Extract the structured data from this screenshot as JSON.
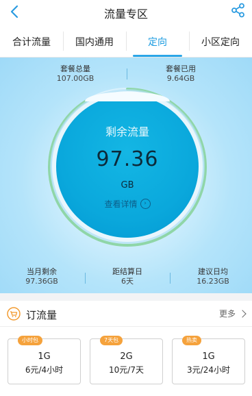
{
  "header": {
    "title": "流量专区",
    "back_icon": "chevron-left-icon",
    "share_icon": "share-icon"
  },
  "tabs": [
    {
      "label": "合计流量",
      "active": false
    },
    {
      "label": "国内通用",
      "active": false
    },
    {
      "label": "定向",
      "active": true
    },
    {
      "label": "小区定向",
      "active": false
    }
  ],
  "summary": {
    "total_label": "套餐总量",
    "total_value": "107.00GB",
    "used_label": "套餐已用",
    "used_value": "9.64GB"
  },
  "ball": {
    "label": "剩余流量",
    "value": "97.36",
    "unit": "GB",
    "detail": "查看详情",
    "remaining_fraction": 0.91
  },
  "bottom_stats": [
    {
      "label": "当月剩余",
      "value": "97.36GB"
    },
    {
      "label": "距结算日",
      "value": "6天"
    },
    {
      "label": "建议日均",
      "value": "16.23GB"
    }
  ],
  "order": {
    "title": "订流量",
    "more": "更多",
    "cards": [
      {
        "tag": "小时包",
        "size": "1G",
        "price": "6元/4小时"
      },
      {
        "tag": "7天包",
        "size": "2G",
        "price": "10元/7天"
      },
      {
        "tag": "热卖",
        "size": "1G",
        "price": "3元/24小时"
      }
    ]
  },
  "colors": {
    "accent": "#1a9be0",
    "ball": "#0aa8dc",
    "tag": "#f5a23c",
    "ring": "#8fd6a8"
  }
}
